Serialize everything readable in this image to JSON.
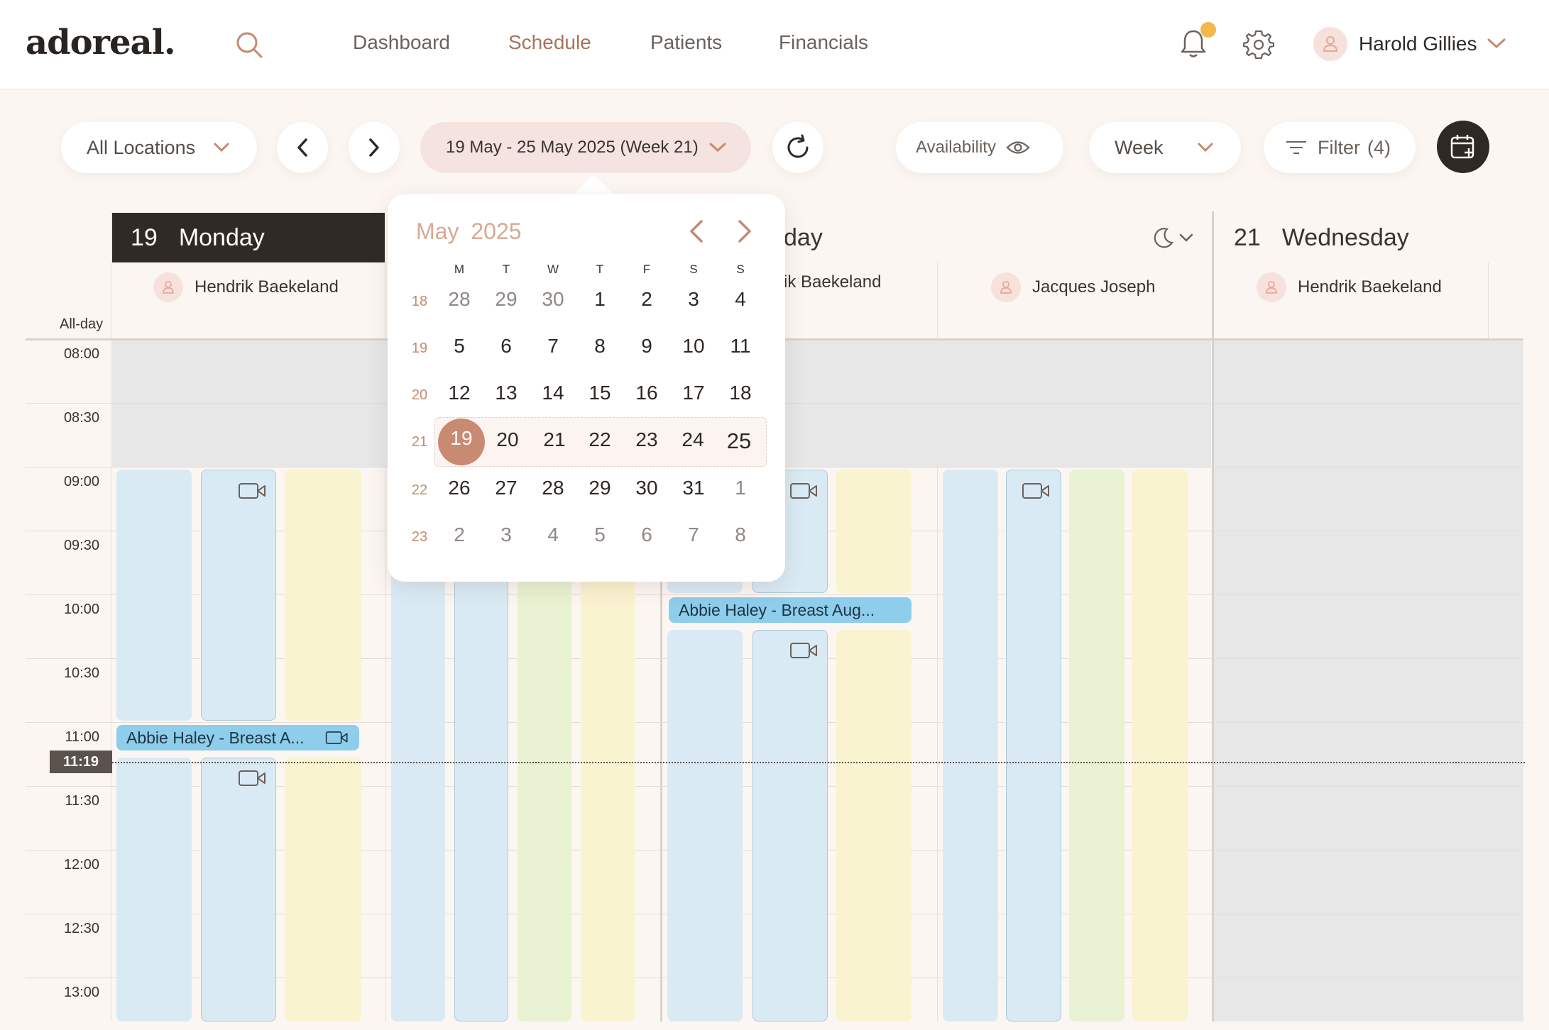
{
  "app": {
    "logo": "adoreal.",
    "nav": [
      "Dashboard",
      "Schedule",
      "Patients",
      "Financials"
    ],
    "active_nav": "Schedule",
    "user_name": "Harold Gillies"
  },
  "toolbar": {
    "location": "All Locations",
    "date_range": "19 May - 25 May 2025 (Week 21)",
    "availability": "Availability",
    "view": "Week",
    "filter": "Filter",
    "filter_count": "(4)"
  },
  "calendar": {
    "all_day_label": "All-day",
    "times": [
      "08:00",
      "08:30",
      "09:00",
      "09:30",
      "10:00",
      "10:30",
      "11:00",
      "11:30",
      "12:00",
      "12:30",
      "13:00"
    ],
    "now": "11:19",
    "days": [
      {
        "num": "19",
        "name": "Monday"
      },
      {
        "partial_name": "day"
      },
      {
        "num": "21",
        "name": "Wednesday"
      }
    ],
    "resources": [
      "Hendrik Baekeland",
      "rik Baekeland",
      "Jacques Joseph",
      "Hendrik Baekeland"
    ],
    "events": [
      {
        "label": "Abbie Haley - Breast A..."
      },
      {
        "label": "Abbie Haley - Breast Aug..."
      }
    ]
  },
  "picker": {
    "month": "May",
    "year": "2025",
    "weekdays": [
      "M",
      "T",
      "W",
      "T",
      "F",
      "S",
      "S"
    ],
    "weeks": [
      {
        "wk": "18",
        "days": [
          "28",
          "29",
          "30",
          "1",
          "2",
          "3",
          "4"
        ]
      },
      {
        "wk": "19",
        "days": [
          "5",
          "6",
          "7",
          "8",
          "9",
          "10",
          "11"
        ]
      },
      {
        "wk": "20",
        "days": [
          "12",
          "13",
          "14",
          "15",
          "16",
          "17",
          "18"
        ]
      },
      {
        "wk": "21",
        "days": [
          "19",
          "20",
          "21",
          "22",
          "23",
          "24",
          "25"
        ]
      },
      {
        "wk": "22",
        "days": [
          "26",
          "27",
          "28",
          "29",
          "30",
          "31",
          "1"
        ]
      },
      {
        "wk": "23",
        "days": [
          "2",
          "3",
          "4",
          "5",
          "6",
          "7",
          "8"
        ]
      }
    ],
    "selected": "19"
  },
  "colors": {
    "accent": "#c98a72",
    "dark": "#302a27",
    "slot_blue": "#daeaf4",
    "slot_yellow": "#faf3d0",
    "slot_green": "#e9f2d2",
    "event_blue": "#8ecdeb",
    "notification_dot": "#f2b84b"
  }
}
